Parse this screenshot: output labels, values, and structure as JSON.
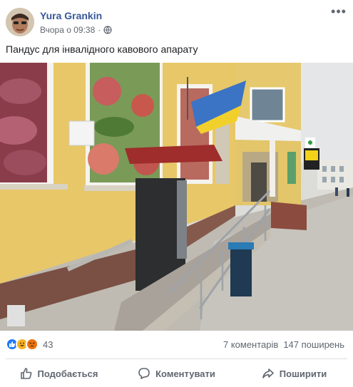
{
  "post": {
    "author": "Yura Grankin",
    "time": "Вчора о 09:38",
    "separator": "·",
    "text": "Пандус для інвалідного кавового апарату",
    "more_label": "•••"
  },
  "icons": {
    "avatar": "avatar",
    "privacy": "globe-icon",
    "like": "like-icon",
    "comment": "comment-icon",
    "share": "share-icon"
  },
  "reactions": {
    "count": "43",
    "types": [
      "like",
      "haha",
      "angry"
    ]
  },
  "stats": {
    "comments": "7 коментарів",
    "shares": "147 поширень"
  },
  "actions": {
    "like": "Подобається",
    "comment": "Коментувати",
    "share": "Поширити"
  },
  "colors": {
    "author": "#385898",
    "like": "#2078f4",
    "haha": "#f7b125",
    "angry": "#e9710f"
  }
}
